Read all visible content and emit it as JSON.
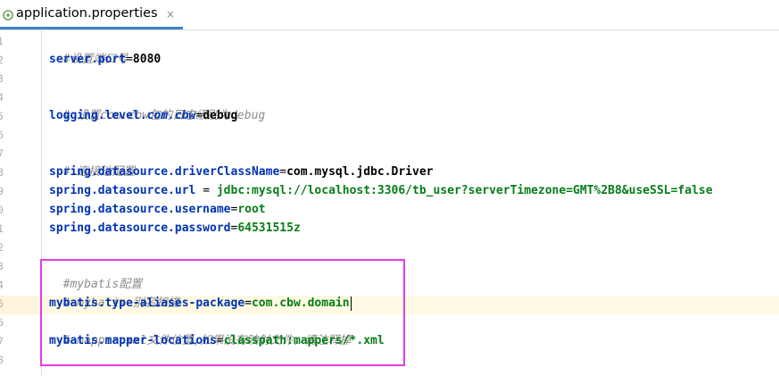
{
  "tab": {
    "label": "application.properties",
    "close": "×"
  },
  "colors": {
    "accent": "#4083c9",
    "highlight_box": "#e53ce5",
    "keyword": "#0033b3",
    "string": "#067d17",
    "comment": "#8c8c8c"
  },
  "line_numbers": [
    "1",
    "2",
    "3",
    "4",
    "5",
    "6",
    "7",
    "8",
    "9",
    "0",
    "1",
    "2",
    "3",
    "4",
    "5",
    "6",
    "7",
    "8"
  ],
  "code": {
    "l1": "#设置端口号",
    "l2_key": "server.port",
    "l2_eq": "=",
    "l2_val": "8080",
    "l4": "# 设置com.cbw包的日志级别为debug",
    "l5_key_a": "logging.level.",
    "l5_key_b": "com.cbw",
    "l5_eq": "=",
    "l5_val": "debug",
    "l7": "# 连接池配置",
    "l8_key": "spring.datasource.driverClassName",
    "l8_eq": "=",
    "l8_val_a": "com.mysql.jdbc.Driver",
    "l9_key": "spring.datasource.url",
    "l9_eq": " = ",
    "l9_val": "jdbc:mysql://localhost:3306/tb_user?serverTimezone=GMT%2B8&useSSL=false",
    "l10_key": "spring.datasource.username",
    "l10_eq": "=",
    "l10_val": "root",
    "l11_key": "spring.datasource.password",
    "l11_eq": "=",
    "l11_val": "64531515z",
    "l13": "#mybatis配置",
    "l14": "# mybatis 别名扫描",
    "l15_key": "mybatis.type-aliases-package",
    "l15_eq": "=",
    "l15_val": "com.cbw.domain",
    "l16": "# mapper.xml文件位置,如果没有映射文件，请注释掉",
    "l17_key": "mybatis.mapper-locations",
    "l17_eq": "=",
    "l17_val": "classpath:mappers/*.xml"
  }
}
